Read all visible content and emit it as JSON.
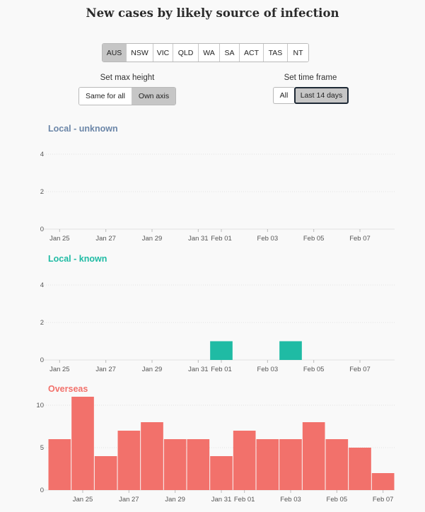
{
  "title": "New cases by likely source of infection",
  "states": [
    "AUS",
    "NSW",
    "VIC",
    "QLD",
    "WA",
    "SA",
    "ACT",
    "TAS",
    "NT"
  ],
  "selected_state": "AUS",
  "max_height": {
    "label": "Set max height",
    "options": [
      "Same for all",
      "Own axis"
    ],
    "selected": "Own axis"
  },
  "time_frame": {
    "label": "Set time frame",
    "options": [
      "All",
      "Last 14 days"
    ],
    "selected": "Last 14 days"
  },
  "colors": {
    "local_unknown": "#6b86a8",
    "local_known": "#1fbba4",
    "overseas": "#f2716b",
    "gridline": "#e2e2e2",
    "tick_text": "#555555"
  },
  "chart_data": [
    {
      "type": "bar",
      "title": "Local - unknown",
      "x": [
        "Jan 25",
        "Jan 26",
        "Jan 27",
        "Jan 28",
        "Jan 29",
        "Jan 30",
        "Jan 31",
        "Feb 01",
        "Feb 02",
        "Feb 03",
        "Feb 04",
        "Feb 05",
        "Feb 06",
        "Feb 07",
        "Feb 08"
      ],
      "values": [
        0,
        0,
        0,
        0,
        0,
        0,
        0,
        0,
        0,
        0,
        0,
        0,
        0,
        0,
        0
      ],
      "ylim": [
        0,
        4
      ],
      "yticks": [
        0,
        2,
        4
      ],
      "xtick_labels": [
        "Jan 25",
        "Jan 27",
        "Jan 29",
        "Jan 31",
        "Feb 01",
        "Feb 03",
        "Feb 05",
        "Feb 07"
      ],
      "grid": true
    },
    {
      "type": "bar",
      "title": "Local - known",
      "x": [
        "Jan 25",
        "Jan 26",
        "Jan 27",
        "Jan 28",
        "Jan 29",
        "Jan 30",
        "Jan 31",
        "Feb 01",
        "Feb 02",
        "Feb 03",
        "Feb 04",
        "Feb 05",
        "Feb 06",
        "Feb 07",
        "Feb 08"
      ],
      "values": [
        0,
        0,
        0,
        0,
        0,
        0,
        0,
        1,
        0,
        0,
        1,
        0,
        0,
        0,
        0
      ],
      "ylim": [
        0,
        4
      ],
      "yticks": [
        0,
        2,
        4
      ],
      "xtick_labels": [
        "Jan 25",
        "Jan 27",
        "Jan 29",
        "Jan 31",
        "Feb 01",
        "Feb 03",
        "Feb 05",
        "Feb 07"
      ],
      "grid": true
    },
    {
      "type": "bar",
      "title": "Overseas",
      "x": [
        "Jan 24",
        "Jan 25",
        "Jan 26",
        "Jan 27",
        "Jan 28",
        "Jan 29",
        "Jan 30",
        "Jan 31",
        "Feb 01",
        "Feb 02",
        "Feb 03",
        "Feb 04",
        "Feb 05",
        "Feb 06",
        "Feb 07"
      ],
      "values": [
        6,
        11,
        4,
        7,
        8,
        6,
        6,
        4,
        7,
        6,
        6,
        8,
        6,
        5,
        2
      ],
      "ylim": [
        0,
        11
      ],
      "yticks": [
        0,
        5,
        10
      ],
      "xtick_labels": [
        "Jan 25",
        "Jan 27",
        "Jan 29",
        "Jan 31",
        "Feb 01",
        "Feb 03",
        "Feb 05",
        "Feb 07"
      ],
      "grid": true
    }
  ]
}
